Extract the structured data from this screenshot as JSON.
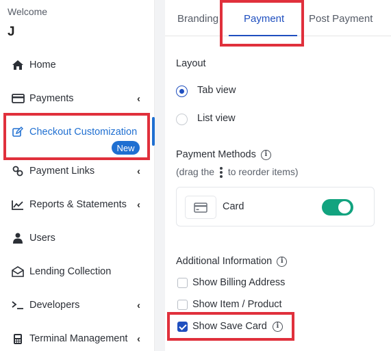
{
  "sidebar": {
    "welcome": "Welcome",
    "user_initial": "J",
    "items": [
      {
        "label": "Home",
        "icon": "home-icon"
      },
      {
        "label": "Payments",
        "icon": "credit-card-icon",
        "chevron": "‹"
      },
      {
        "label": "Checkout Customization",
        "icon": "edit-icon",
        "badge": "New"
      },
      {
        "label": "Payment Links",
        "icon": "link-icon",
        "chevron": "‹"
      },
      {
        "label": "Reports & Statements",
        "icon": "chart-line-icon",
        "chevron": "‹"
      },
      {
        "label": "Users",
        "icon": "user-icon"
      },
      {
        "label": "Lending Collection",
        "icon": "envelope-icon"
      },
      {
        "label": "Developers",
        "icon": "terminal-icon",
        "chevron": "‹"
      },
      {
        "label": "Terminal Management",
        "icon": "terminal-device-icon",
        "chevron": "‹"
      }
    ]
  },
  "tabs": [
    "Branding",
    "Payment",
    "Post Payment"
  ],
  "active_tab": "Payment",
  "layout": {
    "title": "Layout",
    "options": [
      "Tab view",
      "List view"
    ],
    "selected": "Tab view"
  },
  "payment_methods": {
    "title": "Payment Methods",
    "hint_prefix": "(drag the",
    "hint_suffix": "to reorder items)",
    "card_label": "Card",
    "card_enabled": true
  },
  "additional_info": {
    "title": "Additional Information",
    "options": [
      {
        "label": "Show Billing Address",
        "checked": false
      },
      {
        "label": "Show Item / Product",
        "checked": false
      },
      {
        "label": "Show Save Card",
        "checked": true
      }
    ]
  },
  "colors": {
    "accent": "#1f4fbf",
    "highlight": "#e0303c",
    "toggle_on": "#12a37f"
  }
}
